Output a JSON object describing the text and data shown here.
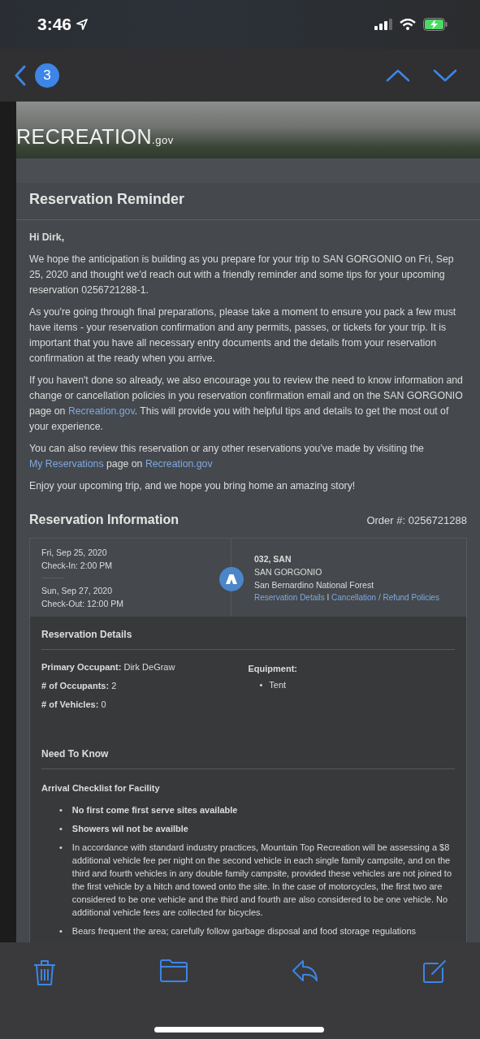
{
  "status_bar": {
    "time": "3:46"
  },
  "nav": {
    "badge": "3"
  },
  "banner": {
    "logo": "RECREATION",
    "logo_suffix": ".gov"
  },
  "email": {
    "title": "Reservation Reminder",
    "greeting": "Hi Dirk,",
    "paragraphs": [
      [
        {
          "text": "We hope the anticipation is building as you prepare for your trip to SAN GORGONIO on Fri, Sep 25, 2020 and thought we'd reach out with a friendly reminder and some tips for your upcoming reservation 0256721288-1."
        }
      ],
      [
        {
          "text": "As you're going through final preparations, please take a moment to ensure you pack a few must have items - your reservation confirmation and any permits, passes, or tickets for your trip. It is important that you have all necessary entry documents and the details from your reservation confirmation at the ready when you arrive."
        }
      ],
      [
        {
          "text": "If you haven't done so already, we also encourage you to review the need to know information and change or cancellation policies in you reservation confirmation email and on the SAN GORGONIO page on "
        },
        {
          "text": "Recreation.gov",
          "link": true
        },
        {
          "text": ". This will provide you with helpful tips and details to get the most out of your experience."
        }
      ],
      [
        {
          "text": "You can also review this reservation or any other reservations you've made by visiting the "
        },
        {
          "text": "My Reservations",
          "link": true
        },
        {
          "text": " page on "
        },
        {
          "text": "Recreation.gov",
          "link": true
        }
      ],
      [
        {
          "text": "Enjoy your upcoming trip, and we hope you bring home an amazing story!"
        }
      ]
    ]
  },
  "info": {
    "title": "Reservation Information",
    "order": "Order #: 0256721288",
    "check_in_date": "Fri, Sep 25, 2020",
    "check_in": "Check-In: 2:00 PM",
    "check_out_date": "Sun, Sep 27, 2020",
    "check_out": "Check-Out: 12:00 PM",
    "site": "032, SAN",
    "facility": "SAN GORGONIO",
    "forest": "San Bernardino National Forest",
    "links": [
      "Reservation Details",
      "Cancellation / Refund Policies"
    ],
    "separator": "I"
  },
  "details": {
    "title": "Reservation Details",
    "fields": [
      {
        "label": "Primary Occupant:",
        "value": "Dirk DeGraw"
      },
      {
        "label": "# of Occupants:",
        "value": "2"
      },
      {
        "label": "# of Vehicles:",
        "value": "0"
      }
    ],
    "equipment_label": "Equipment:",
    "bullet": "•",
    "equipment": [
      "Tent"
    ]
  },
  "need_to_know": {
    "title": "Need To Know",
    "subtitle": "Arrival Checklist for Facility",
    "bullet": "•",
    "items": [
      {
        "text": "No first come first serve sites available",
        "bold": true
      },
      {
        "text": "Showers wil not be availble",
        "bold": true
      },
      {
        "text": "In accordance with standard industry practices, Mountain Top Recreation will be assessing a $8 additional vehicle fee per night on the second vehicle in each single family campsite, and on the third and fourth vehicles in any double family campsite, provided these vehicles are not joined to the first vehicle by a hitch and towed onto the site. In the case of motorcycles, the first two are considered to be one vehicle and the third and fourth are also considered to be one vehicle. No additional vehicle fees are collected for bicycles.",
        "bold": false
      },
      {
        "text": "Bears frequent the area; carefully follow garbage disposal and food storage regulations",
        "bold": false
      }
    ]
  }
}
